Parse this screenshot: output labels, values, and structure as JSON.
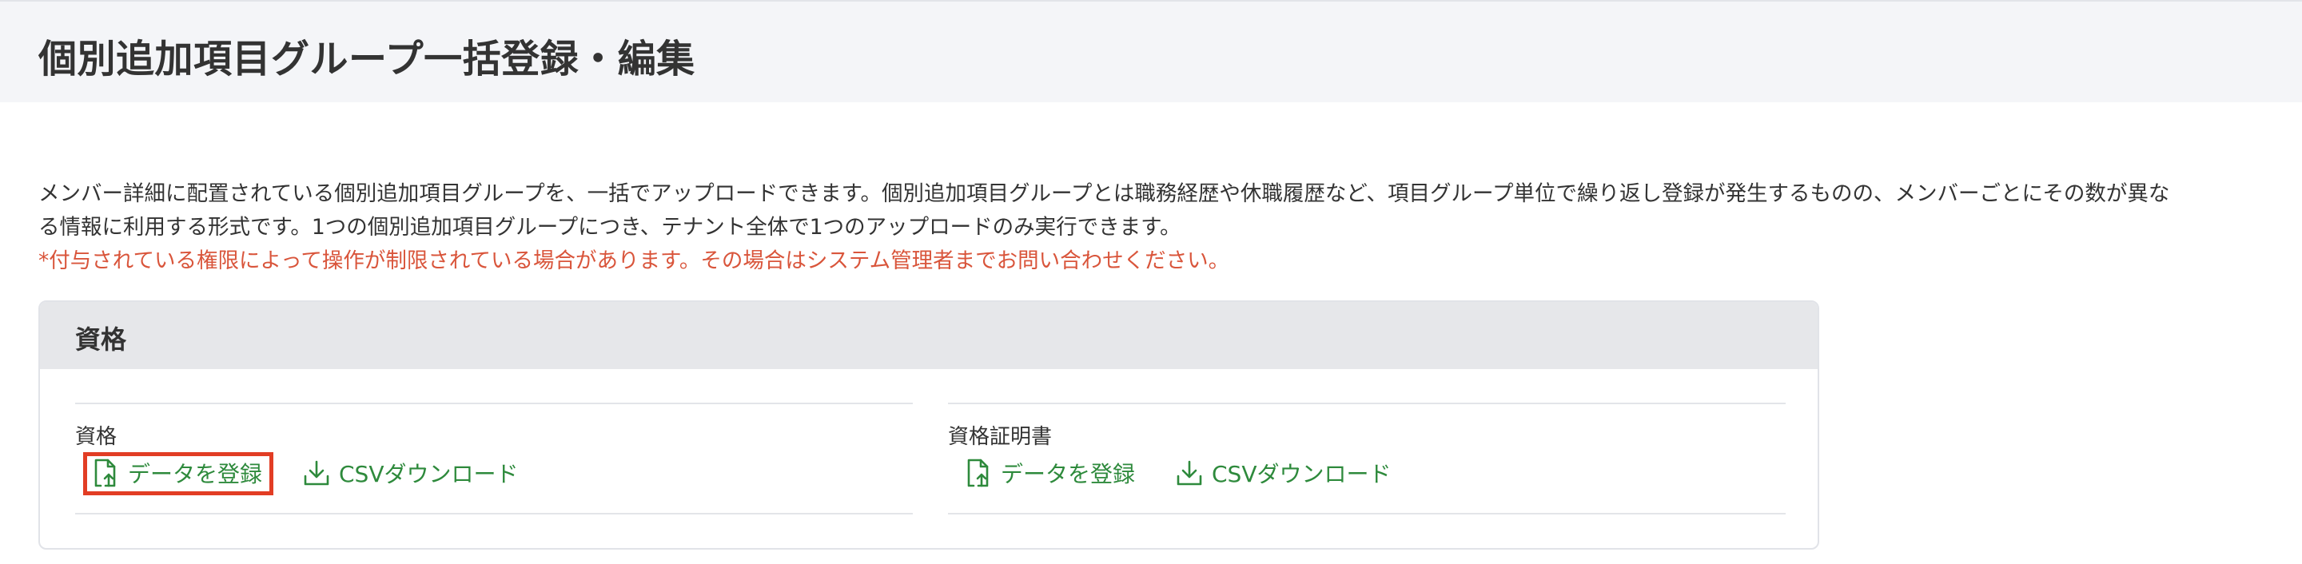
{
  "page": {
    "title": "個別追加項目グループ一括登録・編集"
  },
  "description": {
    "line1": "メンバー詳細に配置されている個別追加項目グループを、一括でアップロードできます。個別追加項目グループとは職務経歴や休職履歴など、項目グループ単位で繰り返し登録が発生するものの、メンバーごとにその数が異な",
    "line2": "る情報に利用する形式です。1つの個別追加項目グループにつき、テナント全体で1つのアップロードのみ実行できます。",
    "warning": "*付与されている権限によって操作が制限されている場合があります。その場合はシステム管理者までお問い合わせください。"
  },
  "group": {
    "title": "資格",
    "items": [
      {
        "label": "資格",
        "register_label": "データを登録",
        "download_label": "CSVダウンロード"
      },
      {
        "label": "資格証明書",
        "register_label": "データを登録",
        "download_label": "CSVダウンロード"
      }
    ]
  },
  "icons": {
    "register": "file-upload-icon",
    "download": "download-icon"
  },
  "colors": {
    "header_bg": "#f4f5f8",
    "link": "#2e8a3c",
    "warning": "#d9553b",
    "highlight": "#e23d24",
    "card_header_bg": "#e6e7ea"
  }
}
